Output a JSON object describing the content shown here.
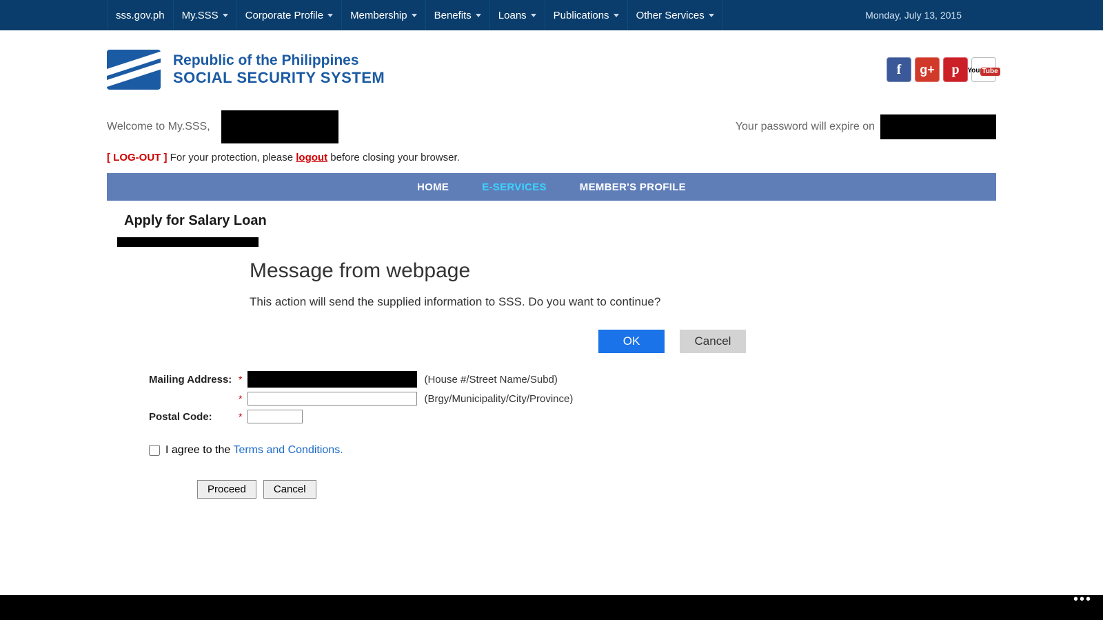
{
  "navbar": {
    "items": [
      {
        "label": "sss.gov.ph",
        "dropdown": false
      },
      {
        "label": "My.SSS",
        "dropdown": true
      },
      {
        "label": "Corporate Profile",
        "dropdown": true
      },
      {
        "label": "Membership",
        "dropdown": true
      },
      {
        "label": "Benefits",
        "dropdown": true
      },
      {
        "label": "Loans",
        "dropdown": true
      },
      {
        "label": "Publications",
        "dropdown": true
      },
      {
        "label": "Other Services",
        "dropdown": true
      }
    ],
    "date": "Monday, July 13, 2015"
  },
  "brand": {
    "line1": "Republic of the Philippines",
    "line2": "SOCIAL SECURITY SYSTEM"
  },
  "social": {
    "fb": "f",
    "gp": "g+",
    "pin": "p",
    "yt_top": "You",
    "yt_bottom": "Tube"
  },
  "welcome": {
    "prefix": "Welcome to My.SSS,",
    "pw_expire_text": "Your password will expire on"
  },
  "logout": {
    "bracket": "[ LOG-OUT ]",
    "before": " For your protection, please ",
    "link": "logout",
    "after": " before closing your browser."
  },
  "subnav": {
    "home": "HOME",
    "eservices": "E-SERVICES",
    "member": "MEMBER'S PROFILE"
  },
  "page": {
    "title": "Apply for Salary Loan"
  },
  "dialog": {
    "title": "Message from webpage",
    "message": "This action will send the supplied information to SSS. Do you want to continue?",
    "ok": "OK",
    "cancel": "Cancel"
  },
  "form": {
    "mail_label": "Mailing Address:",
    "hint1": "(House #/Street Name/Subd)",
    "hint2": "(Brgy/Municipality/City/Province)",
    "postal_label": "Postal Code:",
    "brgy_value": "",
    "postal_value": "",
    "agree_prefix": "I agree to the ",
    "tc": "Terms and Conditions.",
    "proceed": "Proceed",
    "cancel": "Cancel"
  }
}
